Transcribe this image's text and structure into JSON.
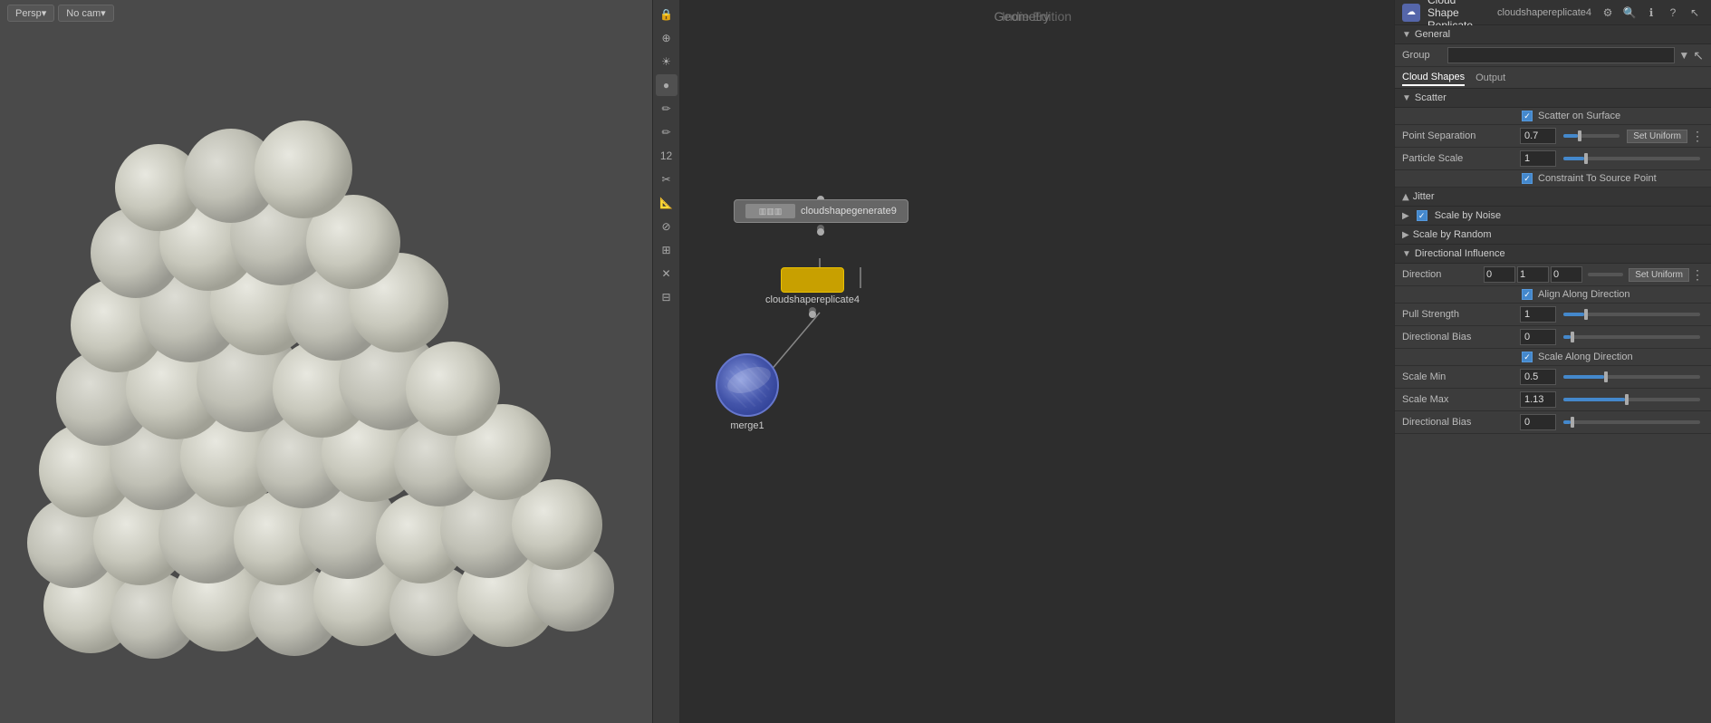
{
  "viewport": {
    "perspective_btn": "Persp▾",
    "camera_btn": "No cam▾"
  },
  "node_editor": {
    "edition_text": "Indie Edition",
    "geometry_text": "Geometry",
    "nodes": {
      "generate": {
        "label": "cloudshapegenerate9"
      },
      "replicate": {
        "label": "cloudshapereplicate4"
      },
      "merge": {
        "label": "merge1"
      }
    }
  },
  "panel": {
    "title": "Cloud Shape Replicate",
    "node_name": "cloudshapereplicate4",
    "tabs": {
      "cloud_shapes": "Cloud Shapes",
      "output": "Output"
    },
    "sections": {
      "general": "General",
      "scatter": "Scatter",
      "jitter": "Jitter",
      "scale_by_noise": "Scale by Noise",
      "scale_by_random": "Scale by Random",
      "directional_influence": "Directional Influence"
    },
    "group": {
      "label": "Group",
      "value": ""
    },
    "scatter": {
      "scatter_on_surface": "Scatter on Surface",
      "point_separation_label": "Point Separation",
      "point_separation_value": "0.7",
      "set_uniform_btn": "Set Uniform",
      "particle_scale_label": "Particle Scale",
      "particle_scale_value": "1",
      "constraint_to_source": "Constraint To Source Point"
    },
    "directional": {
      "direction_label": "Direction",
      "direction_x": "0",
      "direction_y": "1",
      "direction_z": "0",
      "set_uniform_btn": "Set Uniform",
      "align_along_direction": "Align Along Direction",
      "pull_strength_label": "Pull Strength",
      "pull_strength_value": "1",
      "directional_bias_label": "Directional Bias",
      "directional_bias_value": "0",
      "scale_along_direction": "Scale Along Direction",
      "scale_min_label": "Scale Min",
      "scale_min_value": "0.5",
      "scale_max_label": "Scale Max",
      "scale_max_value": "1.13",
      "dir_bias_label": "Directional Bias",
      "dir_bias_value": "0"
    },
    "toolbar": {
      "settings_icon": "⚙",
      "search_icon": "🔍",
      "info_icon": "ℹ",
      "help_icon": "?",
      "cursor_icon": "↖"
    }
  },
  "toolbar_icons": [
    "🔒",
    "⊕",
    "☀",
    "🔵",
    "🖊",
    "🖊",
    "12",
    "✂",
    "📐",
    "📏",
    "🗺",
    "✕",
    "🗺"
  ]
}
